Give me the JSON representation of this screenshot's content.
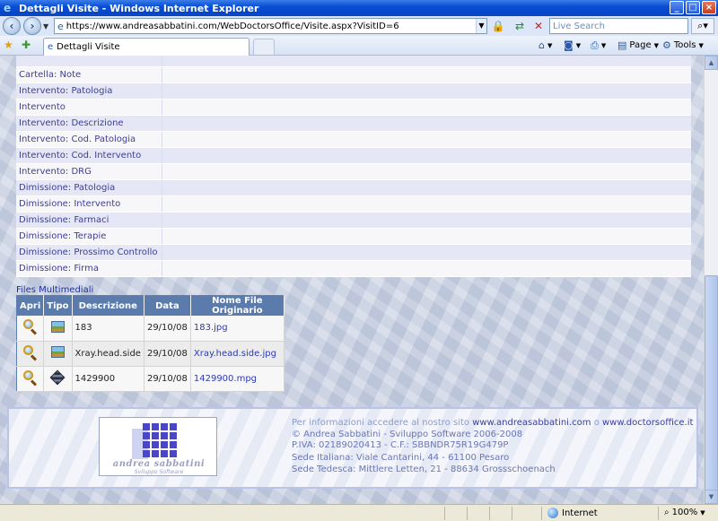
{
  "window": {
    "title": "Dettagli Visite - Windows Internet Explorer",
    "min": "_",
    "max": "□",
    "close": "×"
  },
  "browser": {
    "url": "https://www.andreasabbatini.com/WebDoctorsOffice/Visite.aspx?VisitID=6",
    "search_placeholder": "Live Search",
    "tab_title": "Dettagli Visite",
    "cmd_page": "Page",
    "cmd_tools": "Tools"
  },
  "details": {
    "rows": [
      {
        "label": "Cartella: Note",
        "value": ""
      },
      {
        "label": "Intervento: Patologia",
        "value": ""
      },
      {
        "label": "Intervento",
        "value": ""
      },
      {
        "label": "Intervento: Descrizione",
        "value": ""
      },
      {
        "label": "Intervento: Cod. Patologia",
        "value": ""
      },
      {
        "label": "Intervento: Cod. Intervento",
        "value": ""
      },
      {
        "label": "Intervento: DRG",
        "value": ""
      },
      {
        "label": "Dimissione: Patologia",
        "value": ""
      },
      {
        "label": "Dimissione: Intervento",
        "value": ""
      },
      {
        "label": "Dimissione: Farmaci",
        "value": ""
      },
      {
        "label": "Dimissione: Terapie",
        "value": ""
      },
      {
        "label": "Dimissione: Prossimo Controllo",
        "value": ""
      },
      {
        "label": "Dimissione: Firma",
        "value": ""
      }
    ]
  },
  "files": {
    "title": "Files Multimediali",
    "headers": [
      "Apri",
      "Tipo",
      "Descrizione",
      "Data",
      "Nome File Originario"
    ],
    "rows": [
      {
        "type": "image",
        "description": "183",
        "date": "29/10/08",
        "filename": "183.jpg"
      },
      {
        "type": "image",
        "description": "Xray.head.side",
        "date": "29/10/08",
        "filename": "Xray.head.side.jpg"
      },
      {
        "type": "video",
        "description": "1429900",
        "date": "29/10/08",
        "filename": "1429900.mpg"
      }
    ]
  },
  "footer": {
    "logo_text": "andrea sabbatini",
    "logo_sub": "Sviluppo Software",
    "info_prefix": "Per informazioni accedere al nostro sito",
    "site1": "www.andreasabbatini.com",
    "or": "o",
    "site2": "www.doctorsoffice.it",
    "copyright": "© Andrea Sabbatini - Sviluppo Software 2006-2008",
    "piva": "P.IVA: 02189020413 - C.F.: SBBNDR75R19G479P",
    "sede_it": "Sede Italiana: Viale Cantarini, 44 - 61100 Pesaro",
    "sede_de": "Sede Tedesca: Mittlere Letten, 21 - 88634 Grossschoenach"
  },
  "status": {
    "zone": "Internet",
    "zoom": "100%"
  }
}
